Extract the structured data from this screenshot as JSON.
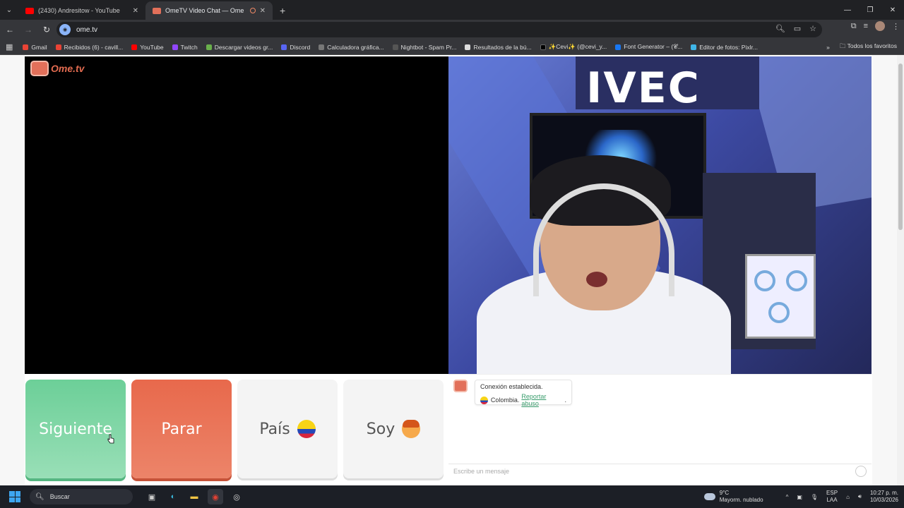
{
  "browser": {
    "tabs": [
      {
        "title": "(2430) Andresitow - YouTube",
        "favicon_color": "#ff0000"
      },
      {
        "title": "OmeTV Video Chat — Ome",
        "favicon_color": "#e2705a"
      }
    ],
    "url": "ome.tv",
    "bookmarks": [
      {
        "label": "Gmail",
        "color": "#ea4335"
      },
      {
        "label": "Recibidos (6) - cavill...",
        "color": "#ea4335"
      },
      {
        "label": "YouTube",
        "color": "#ff0000"
      },
      {
        "label": "Twitch",
        "color": "#9146ff"
      },
      {
        "label": "Descargar videos gr...",
        "color": "#6ab04c"
      },
      {
        "label": "Discord",
        "color": "#5865f2"
      },
      {
        "label": "Calculadora gráfica...",
        "color": "#777777"
      },
      {
        "label": "Nightbot - Spam Pr...",
        "color": "#555555"
      },
      {
        "label": "Resultados de la bú...",
        "color": "#dddddd"
      },
      {
        "label": "✨Cevi✨ (@cevi_y...",
        "color": "#000000"
      },
      {
        "label": "Font Generator – (𝓒...",
        "color": "#1877f2"
      },
      {
        "label": "Editor de fotos: Pixlr...",
        "color": "#3fb6e8"
      }
    ],
    "all_bookmarks": "Todos los favoritos"
  },
  "ometv": {
    "logo_text": "Ome.tv",
    "buttons": {
      "next": "Siguiente",
      "stop": "Parar",
      "country": "País",
      "gender": "Soy"
    },
    "chat": {
      "status": "Conexión establecida.",
      "country": "Colombia.",
      "report": "Reportar abuso",
      "report_suffix": ".",
      "input_placeholder": "Escribe un mensaje"
    },
    "stream_wall_text": "IVEC"
  },
  "taskbar": {
    "search_label": "Buscar",
    "weather_temp": "9°C",
    "weather_desc": "Mayorm. nublado",
    "lang_line1": "ESP",
    "lang_line2": "LAA",
    "time": "10:27 p. m.",
    "date": "10/03/2026"
  },
  "colors": {
    "next_button": "#6ccf98",
    "stop_button": "#e8694c",
    "brand": "#e2705a",
    "link": "#3a9d6d"
  }
}
